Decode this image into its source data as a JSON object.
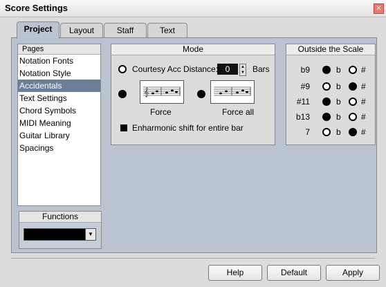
{
  "window": {
    "title": "Score Settings"
  },
  "tabs": [
    {
      "label": "Project",
      "active": true
    },
    {
      "label": "Layout",
      "active": false
    },
    {
      "label": "Staff",
      "active": false
    },
    {
      "label": "Text",
      "active": false
    }
  ],
  "pages": {
    "header": "Pages",
    "items": [
      "Notation Fonts",
      "Notation Style",
      "Accidentals",
      "Text Settings",
      "Chord Symbols",
      "MIDI Meaning",
      "Guitar Library",
      "Spacings"
    ],
    "selected": "Accidentals"
  },
  "functions": {
    "header": "Functions",
    "value": ""
  },
  "mode": {
    "header": "Mode",
    "courtesy_label": "Courtesy Acc Distance:",
    "courtesy_value": "0",
    "bars_label": "Bars",
    "force_label": "Force",
    "force_all_label": "Force all",
    "enharmonic_label": "Enharmonic shift for entire bar"
  },
  "outside_scale": {
    "header": "Outside the Scale",
    "flat_symbol": "b",
    "sharp_symbol": "#",
    "rows": [
      {
        "name": "b9",
        "flat": true
      },
      {
        "name": "#9",
        "flat": false
      },
      {
        "name": "#11",
        "flat": true
      },
      {
        "name": "b13",
        "flat": true
      },
      {
        "name": "7",
        "flat": false
      }
    ]
  },
  "buttons": {
    "help": "Help",
    "default": "Default",
    "apply": "Apply"
  },
  "icons": {
    "close": "close-icon"
  }
}
